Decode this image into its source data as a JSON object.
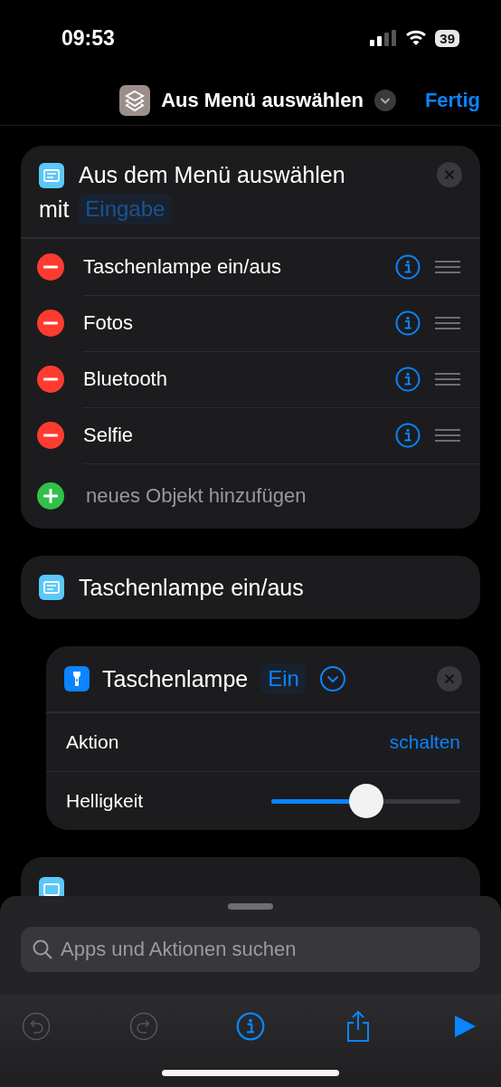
{
  "status_bar": {
    "time": "09:53",
    "battery": "39"
  },
  "nav": {
    "title": "Aus Menü auswählen",
    "done": "Fertig"
  },
  "menu_card": {
    "title": "Aus dem Menü auswählen",
    "with": "mit",
    "variable": "Eingabe",
    "items": [
      {
        "label": "Taschenlampe ein/aus"
      },
      {
        "label": "Fotos"
      },
      {
        "label": "Bluetooth"
      },
      {
        "label": "Selfie"
      }
    ],
    "add": "neues Objekt hinzufügen"
  },
  "case_card": {
    "title": "Taschenlampe ein/aus"
  },
  "action_card": {
    "title": "Taschenlampe",
    "value": "Ein",
    "expanded": true,
    "params": [
      {
        "kind": "text",
        "label": "Aktion",
        "value": "schalten"
      },
      {
        "kind": "slider",
        "label": "Helligkeit",
        "level": 0.5
      }
    ]
  },
  "next_card": {
    "kind": "menu"
  },
  "sheet": {
    "search": {
      "placeholder": "Apps und Aktionen suchen"
    },
    "toolbar": [
      {
        "kind": "undo",
        "disabled": true
      },
      {
        "kind": "redo",
        "disabled": true
      },
      {
        "kind": "info",
        "disabled": false
      },
      {
        "kind": "share",
        "disabled": false
      },
      {
        "kind": "run",
        "disabled": false
      }
    ]
  }
}
